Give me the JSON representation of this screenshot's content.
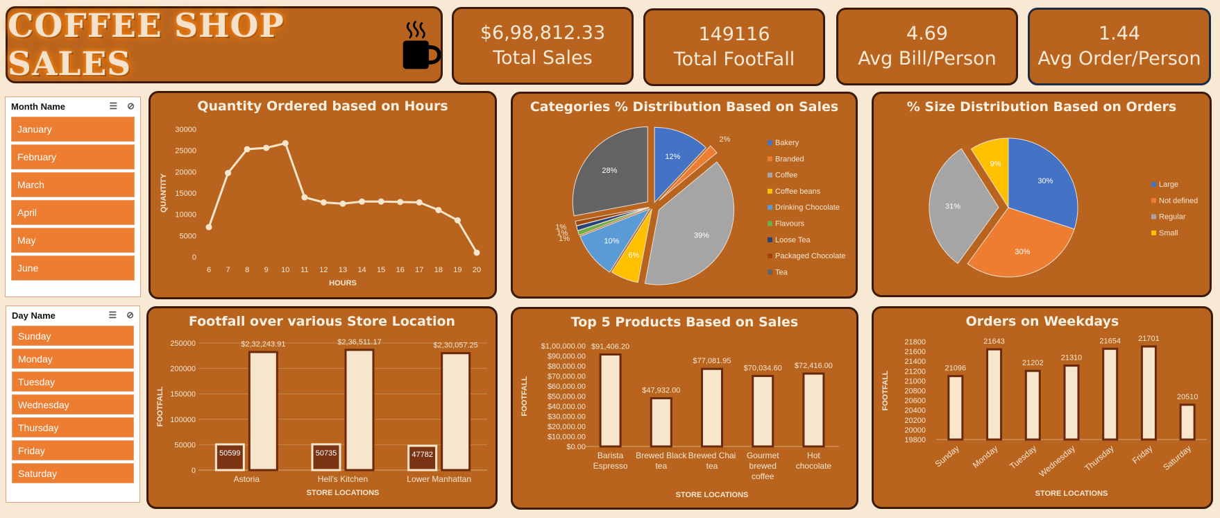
{
  "header": {
    "title": "COFFEE SHOP SALES",
    "icon": "coffee-cup-icon"
  },
  "kpis": [
    {
      "value": "$6,98,812.33",
      "label": "Total Sales"
    },
    {
      "value": "149116",
      "label": "Total FootFall"
    },
    {
      "value": "4.69",
      "label": "Avg Bill/Person"
    },
    {
      "value": "1.44",
      "label": "Avg Order/Person"
    }
  ],
  "slicers": {
    "month": {
      "title": "Month Name",
      "items": [
        "January",
        "February",
        "March",
        "April",
        "May",
        "June"
      ]
    },
    "day": {
      "title": "Day Name",
      "items": [
        "Sunday",
        "Monday",
        "Tuesday",
        "Wednesday",
        "Thursday",
        "Friday",
        "Saturday"
      ]
    }
  },
  "colors": {
    "panel": "#b8641e",
    "bar_light": "#f7e5cc",
    "bar_dark": "#7a3414",
    "accent": "#ed7d31"
  },
  "chart_data": [
    {
      "id": "hours",
      "type": "line",
      "title": "Quantity Ordered based on Hours",
      "xlabel": "HOURS",
      "ylabel": "QUANTITY",
      "x": [
        6,
        7,
        8,
        9,
        10,
        11,
        12,
        13,
        14,
        15,
        16,
        17,
        18,
        19,
        20
      ],
      "values": [
        7000,
        19700,
        25300,
        25600,
        26700,
        14000,
        12800,
        12500,
        13000,
        13000,
        12900,
        12800,
        11000,
        8600,
        1000
      ],
      "ylim": [
        0,
        30000
      ],
      "yticks": [
        "30000",
        "25000",
        "20000",
        "15000",
        "10000",
        "5000",
        "0"
      ]
    },
    {
      "id": "categories",
      "type": "pie",
      "title": "Categories % Distribution Based on Sales",
      "categories": [
        "Bakery",
        "Branded",
        "Coffee",
        "Coffee beans",
        "Drinking Chocolate",
        "Flavours",
        "Loose Tea",
        "Packaged Chocolate",
        "Tea"
      ],
      "values": [
        12,
        2,
        39,
        6,
        10,
        1,
        1,
        1,
        28
      ],
      "labels": [
        "12%",
        "2%",
        "39%",
        "6%",
        "10%",
        "1%",
        "1%",
        "1%",
        "28%"
      ],
      "colors": [
        "#4472c4",
        "#ed7d31",
        "#a5a5a5",
        "#ffc000",
        "#5b9bd5",
        "#70ad47",
        "#264478",
        "#9e480e",
        "#636363"
      ],
      "legend": "right"
    },
    {
      "id": "size",
      "type": "pie",
      "title": "% Size Distribution Based on Orders",
      "categories": [
        "Large",
        "Not defined",
        "Regular",
        "Small"
      ],
      "values": [
        30,
        30,
        31,
        9
      ],
      "labels": [
        "30%",
        "30%",
        "31%",
        "9%"
      ],
      "colors": [
        "#4472c4",
        "#ed7d31",
        "#a5a5a5",
        "#ffc000"
      ],
      "legend": "right"
    },
    {
      "id": "footfall",
      "type": "bar",
      "title": "Footfall over various Store Location",
      "xlabel": "STORE LOCATIONS",
      "ylabel": "FOOTFALL",
      "categories": [
        "Astoria",
        "Hell's Kitchen",
        "Lower Manhattan"
      ],
      "series": [
        {
          "values": [
            50599,
            50735,
            47782
          ],
          "labels": [
            "50599",
            "50735",
            "47782"
          ]
        },
        {
          "values": [
            232243.91,
            236511.17,
            230057.25
          ],
          "labels": [
            "$2,32,243.91",
            "$2,36,511.17",
            "$2,30,057.25"
          ]
        }
      ],
      "ylim": [
        0,
        250000
      ],
      "yticks": [
        "250000",
        "200000",
        "150000",
        "100000",
        "50000",
        "0"
      ]
    },
    {
      "id": "products",
      "type": "bar",
      "title": "Top 5 Products Based on Sales",
      "xlabel": "STORE LOCATIONS",
      "ylabel": "FOOTFALL",
      "categories": [
        [
          "Barista",
          "Espresso"
        ],
        [
          "Brewed Black",
          "tea"
        ],
        [
          "Brewed Chai",
          "tea"
        ],
        [
          "Gourmet",
          "brewed",
          "coffee"
        ],
        [
          "Hot",
          "chocolate"
        ]
      ],
      "values": [
        91406.2,
        47932.0,
        77081.95,
        70034.6,
        72416.0
      ],
      "labels": [
        "$91,406.20",
        "$47,932.00",
        "$77,081.95",
        "$70,034.60",
        "$72,416.00"
      ],
      "ylim": [
        0,
        100000
      ],
      "yticks": [
        "$1,00,000.00",
        "$90,000.00",
        "$80,000.00",
        "$70,000.00",
        "$60,000.00",
        "$50,000.00",
        "$40,000.00",
        "$30,000.00",
        "$20,000.00",
        "$10,000.00",
        "$0.00"
      ]
    },
    {
      "id": "weekdays",
      "type": "bar",
      "title": "Orders on Weekdays",
      "xlabel": "STORE LOCATIONS",
      "ylabel": "FOOTFALL",
      "categories": [
        "Sunday",
        "Monday",
        "Tuesday",
        "Wednesday",
        "Thursday",
        "Friday",
        "Saturday"
      ],
      "values": [
        21096,
        21643,
        21202,
        21310,
        21654,
        21701,
        20510
      ],
      "labels": [
        "21096",
        "21643",
        "21202",
        "21310",
        "21654",
        "21701",
        "20510"
      ],
      "ylim": [
        19800,
        21800
      ],
      "yticks": [
        "21800",
        "21600",
        "21400",
        "21200",
        "21000",
        "20800",
        "20600",
        "20400",
        "20200",
        "20000",
        "19800"
      ]
    }
  ]
}
